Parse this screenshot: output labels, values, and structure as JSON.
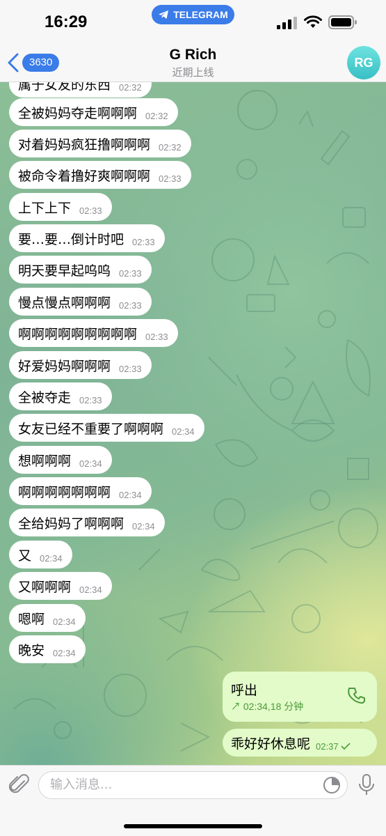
{
  "status_bar": {
    "time": "16:29",
    "app_pill": "TELEGRAM"
  },
  "header": {
    "back_count": "3630",
    "title": "G Rich",
    "subtitle": "近期上线",
    "avatar_initials": "RG"
  },
  "messages": [
    {
      "text": "属于女友的东西",
      "time": "02:32"
    },
    {
      "text": "全被妈妈夺走啊啊啊",
      "time": "02:32"
    },
    {
      "text": "对着妈妈疯狂撸啊啊啊",
      "time": "02:32"
    },
    {
      "text": "被命令着撸好爽啊啊啊",
      "time": "02:33"
    },
    {
      "text": "上下上下",
      "time": "02:33"
    },
    {
      "text": "要…要…倒计时吧",
      "time": "02:33"
    },
    {
      "text": "明天要早起呜呜",
      "time": "02:33"
    },
    {
      "text": "慢点慢点啊啊啊",
      "time": "02:33"
    },
    {
      "text": "啊啊啊啊啊啊啊啊啊",
      "time": "02:33"
    },
    {
      "text": "好爱妈妈啊啊啊",
      "time": "02:33"
    },
    {
      "text": "全被夺走",
      "time": "02:33"
    },
    {
      "text": "女友已经不重要了啊啊啊",
      "time": "02:34"
    },
    {
      "text": "想啊啊啊",
      "time": "02:34"
    },
    {
      "text": "啊啊啊啊啊啊啊",
      "time": "02:34"
    },
    {
      "text": "全给妈妈了啊啊啊",
      "time": "02:34"
    },
    {
      "text": "又",
      "time": "02:34"
    },
    {
      "text": "又啊啊啊",
      "time": "02:34"
    },
    {
      "text": "嗯啊",
      "time": "02:34"
    },
    {
      "text": "晚安",
      "time": "02:34"
    }
  ],
  "outgoing_call": {
    "label": "呼出",
    "meta": "↗ 02:34,18 分钟"
  },
  "outgoing_message": {
    "text": "乖好好休息呢",
    "time": "02:37"
  },
  "input": {
    "placeholder": "输入消息..."
  },
  "colors": {
    "accent": "#3a7ce8",
    "outgoing_bubble": "#e2fbc9",
    "incoming_bubble": "#ffffff",
    "outgoing_meta": "#4b9a38"
  }
}
